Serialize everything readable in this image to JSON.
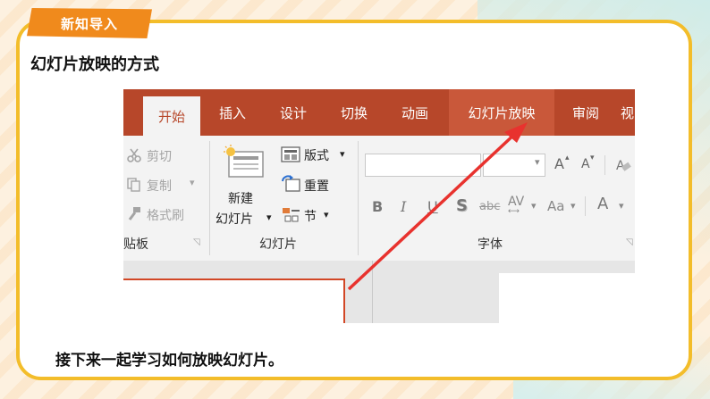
{
  "tag_label": "新知导入",
  "heading": "幻灯片放映的方式",
  "footer": "接下来一起学习如何放映幻灯片。",
  "colors": {
    "accent_orange": "#f08a1c",
    "border_yellow": "#f3bd2a",
    "ppt_red": "#b7472a",
    "arrow_red": "#e8322e"
  },
  "ppt": {
    "tabs": [
      "开始",
      "插入",
      "设计",
      "切换",
      "动画",
      "幻灯片放映",
      "审阅",
      "视"
    ],
    "active_tab": "开始",
    "highlighted_tab": "幻灯片放映",
    "clipboard": {
      "cut": "剪切",
      "copy": "复制",
      "format_painter": "格式刷",
      "group": "贴板"
    },
    "slides": {
      "new_slide_1": "新建",
      "new_slide_2": "幻灯片",
      "layout": "版式",
      "reset": "重置",
      "section": "节",
      "group": "幻灯片"
    },
    "font": {
      "group": "字体",
      "bold": "B",
      "italic": "I",
      "underline": "U",
      "shadow": "S",
      "strike": "abc",
      "spacing": "AV",
      "case": "Aa",
      "grow": "A",
      "shrink": "A",
      "color": "A"
    }
  }
}
